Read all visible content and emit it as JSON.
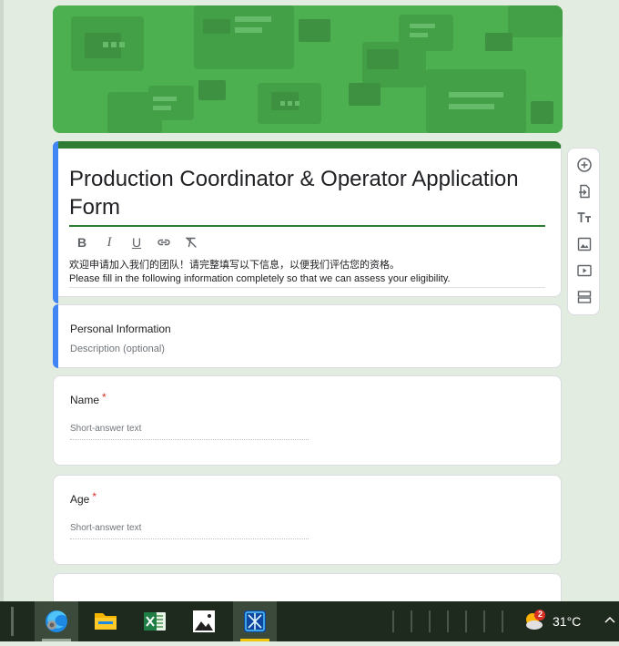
{
  "form": {
    "title": "Production Coordinator & Operator Application Form",
    "description_cn": "欢迎申请加入我们的团队！请完整填写以下信息，以便我们评估您的资格。",
    "description_en": "Please fill in the following information completely so that we can assess your eligibility."
  },
  "format_toolbar": {
    "bold": "B",
    "italic": "I",
    "underline": "U"
  },
  "section": {
    "title": "Personal Information",
    "description_placeholder": "Description (optional)"
  },
  "questions": [
    {
      "label": "Name",
      "required_mark": "*",
      "placeholder": "Short-answer text"
    },
    {
      "label": "Age",
      "required_mark": "*",
      "placeholder": "Short-answer text"
    }
  ],
  "taskbar": {
    "temperature": "31°C",
    "notification_count": "2"
  },
  "colors": {
    "theme_green": "#4caf50",
    "title_border": "#2e7d32",
    "accent_blue": "#4285f4",
    "required_red": "#d93025"
  }
}
